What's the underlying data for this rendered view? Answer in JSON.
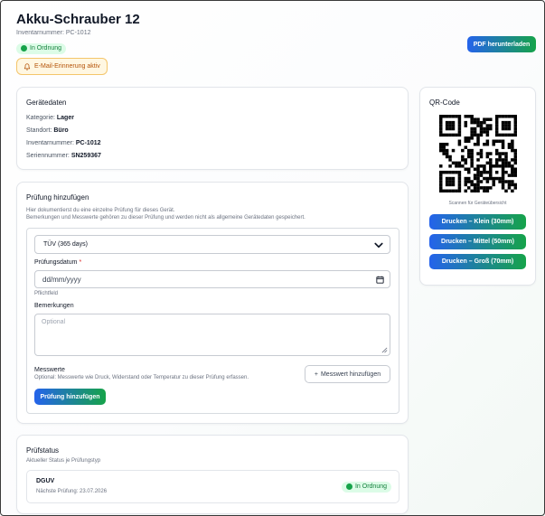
{
  "header": {
    "title": "Akku-Schrauber 12",
    "inventory_subtitle": "Inventarnummer: PC-1012",
    "status_badge": "In Ordnung",
    "email_badge": "E-Mail-Erinnerung aktiv",
    "pdf_button": "PDF herunterladen"
  },
  "device_data": {
    "title": "Gerätedaten",
    "fields": [
      {
        "label": "Kategorie:",
        "value": "Lager"
      },
      {
        "label": "Standort:",
        "value": "Büro"
      },
      {
        "label": "Inventarnummer:",
        "value": "PC-1012"
      },
      {
        "label": "Seriennummer:",
        "value": "SN259367"
      }
    ]
  },
  "add_check": {
    "title": "Prüfung hinzufügen",
    "hint_line1": "Hier dokumentierst du eine einzelne Prüfung für dieses Gerät.",
    "hint_line2": "Bemerkungen und Messwerte gehören zu dieser Prüfung und werden nicht als allgemeine Gerätedaten gespeichert.",
    "type_selected": "TÜV (365 days)",
    "date_label": "Prüfungsdatum",
    "date_required_mark": "*",
    "date_placeholder": "dd/mm/yyyy",
    "required_hint": "Pflichtfeld",
    "remarks_label": "Bemerkungen",
    "remarks_placeholder": "Optional",
    "measurements_label": "Messwerte",
    "measurements_hint": "Optional: Messwerte wie Druck, Widerstand oder Temperatur zu dieser Prüfung erfassen.",
    "add_measurement_button": "Messwert hinzufügen",
    "add_measurement_plus": "+",
    "submit_button": "Prüfung hinzufügen"
  },
  "test_status": {
    "title": "Prüfstatus",
    "subtitle": "Aktueller Status je Prüfungstyp",
    "items": [
      {
        "name": "DGUV",
        "next": "Nächste Prüfung: 23.07.2026",
        "status": "In Ordnung"
      }
    ]
  },
  "qr": {
    "title": "QR-Code",
    "caption": "Scannen für Geräteübersicht",
    "buttons": [
      "Drucken – Klein (30mm)",
      "Drucken – Mittel (50mm)",
      "Drucken – Groß (70mm)"
    ]
  },
  "colors": {
    "ok_green": "#16a34a",
    "brand_blue": "#2563eb",
    "warn_amber": "#b45309"
  }
}
